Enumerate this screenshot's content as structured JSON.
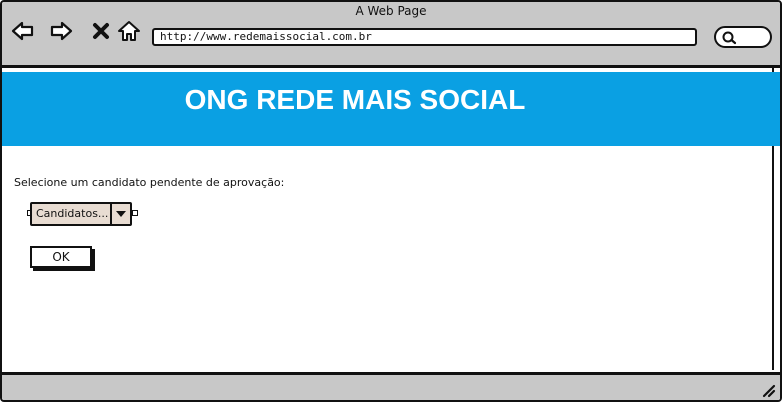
{
  "window": {
    "title": "A Web Page"
  },
  "browser": {
    "url": "http://www.redemaissocial.com.br",
    "icons": [
      "back-arrow-icon",
      "forward-arrow-icon",
      "close-x-icon",
      "home-icon",
      "search-icon",
      "resize-grip-icon"
    ]
  },
  "banner": {
    "title": "ONG REDE MAIS SOCIAL",
    "color": "#0aa0e3"
  },
  "form": {
    "prompt": "Selecione um candidato pendente de aprovação:",
    "select_value": "Candidatos...",
    "ok_label": "OK"
  }
}
